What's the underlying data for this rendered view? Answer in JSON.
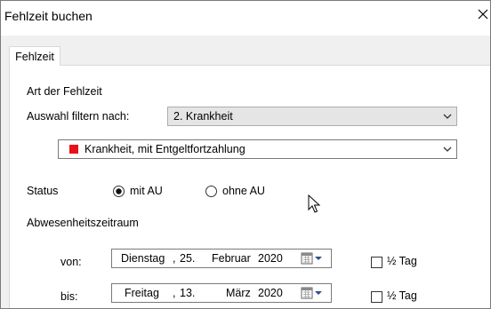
{
  "window": {
    "title": "Fehlzeit buchen"
  },
  "tabs": [
    {
      "label": "Fehlzeit",
      "selected": true
    }
  ],
  "form": {
    "section_art": "Art der Fehlzeit",
    "filter_label": "Auswahl filtern nach:",
    "filter_value": "2. Krankheit",
    "type_value": "Krankheit, mit Entgeltfortzahlung",
    "type_color": "#e8111a",
    "status_label": "Status",
    "status_options": [
      {
        "label": "mit AU",
        "checked": true
      },
      {
        "label": "ohne AU",
        "checked": false
      }
    ],
    "period_label": "Abwesenheitszeitraum",
    "from": {
      "label": "von:",
      "weekday": "Dienstag",
      "day": "25.",
      "month": "Februar",
      "year": "2020",
      "half_day_label": "½ Tag",
      "half_day_checked": false
    },
    "to": {
      "label": "bis:",
      "weekday": "Freitag",
      "day": "13.",
      "month": "März",
      "year": "2020",
      "half_day_label": "½ Tag",
      "half_day_checked": false
    }
  }
}
